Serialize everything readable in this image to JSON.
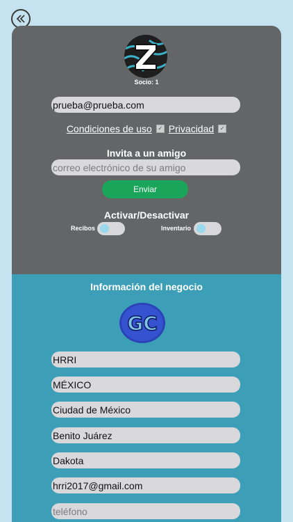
{
  "nav": {
    "back_icon": "double-chevron-left-icon"
  },
  "account": {
    "socio_label": "Socio: 1",
    "email_value": "prueba@prueba.com"
  },
  "terms": {
    "conditions_label": "Condiciones de uso",
    "privacy_label": "Privacidad",
    "conditions_checked": true,
    "privacy_checked": true
  },
  "invite": {
    "title": "Invita a un amigo",
    "email_placeholder": "correo electrónico de su amigo",
    "send_label": "Enviar"
  },
  "activate": {
    "title": "Activar/Desactivar",
    "toggles": [
      {
        "label": "Recibos",
        "on": false
      },
      {
        "label": "Inventario",
        "on": false
      }
    ]
  },
  "business": {
    "title": "Información del negocio",
    "logo_text": "GC",
    "fields": [
      {
        "value": "HRRI",
        "placeholder": ""
      },
      {
        "value": "MÉXICO",
        "placeholder": ""
      },
      {
        "value": "Ciudad de México",
        "placeholder": ""
      },
      {
        "value": "Benito Juárez",
        "placeholder": ""
      },
      {
        "value": "Dakota",
        "placeholder": ""
      },
      {
        "value": "hrri2017@gmail.com",
        "placeholder": ""
      },
      {
        "value": "",
        "placeholder": "teléfono"
      }
    ]
  },
  "colors": {
    "background": "#c4e2ef",
    "top_panel": "#646566",
    "bottom_panel": "#3d9fb7",
    "send_button": "#1aa65a",
    "toggle_knob": "#9ad8ec"
  }
}
